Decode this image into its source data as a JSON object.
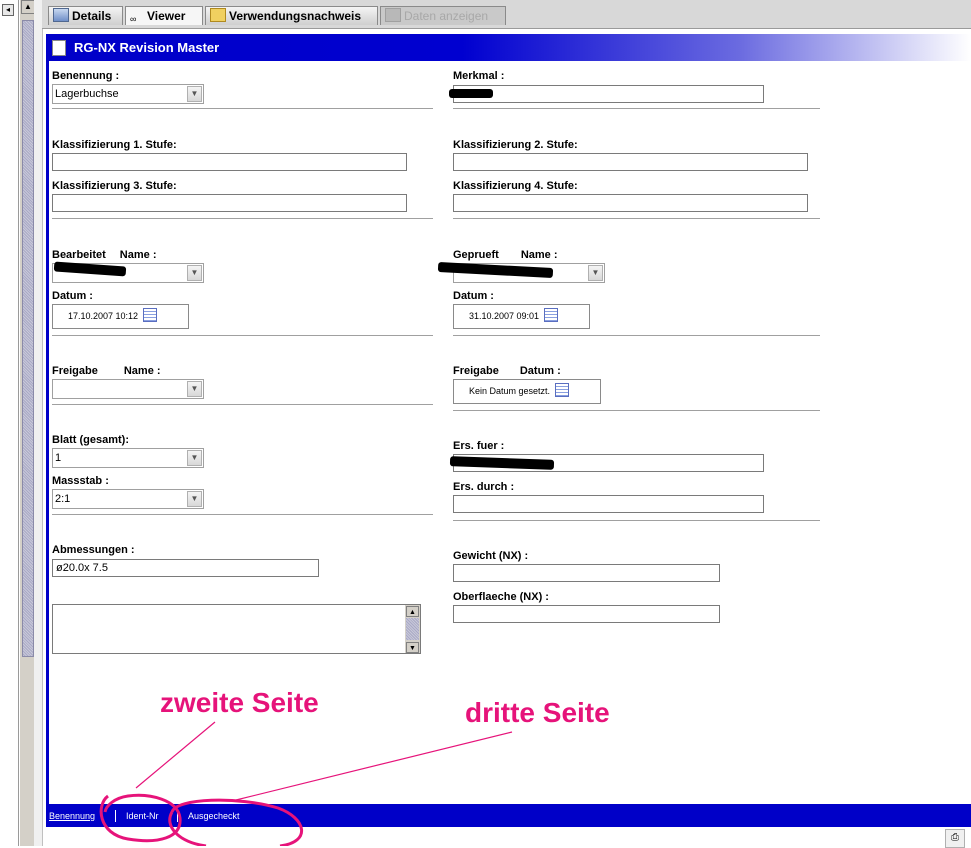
{
  "tabs": [
    {
      "label": "Details",
      "icon": "details-icon",
      "disabled": false
    },
    {
      "label": "Viewer",
      "icon": "glasses-icon",
      "disabled": false
    },
    {
      "label": "Verwendungsnachweis",
      "icon": "folder-icon",
      "disabled": false
    },
    {
      "label": "Daten anzeigen",
      "icon": "data-icon",
      "disabled": true
    }
  ],
  "header": {
    "title": "RG-NX Revision Master"
  },
  "form": {
    "benennung": {
      "label": "Benennung :",
      "value": "Lagerbuchse"
    },
    "merkmal": {
      "label": "Merkmal :",
      "value": ""
    },
    "klass1": {
      "label": "Klassifizierung 1. Stufe:",
      "value": ""
    },
    "klass2": {
      "label": "Klassifizierung 2. Stufe:",
      "value": ""
    },
    "klass3": {
      "label": "Klassifizierung 3. Stufe:",
      "value": ""
    },
    "klass4": {
      "label": "Klassifizierung 4. Stufe:",
      "value": ""
    },
    "bearbeitet": {
      "label_a": "Bearbeitet",
      "label_b": "Name :",
      "value": ""
    },
    "bearbeitet_datum": {
      "label": "Datum :",
      "value": "17.10.2007 10:12"
    },
    "geprueft": {
      "label_a": "Geprueft",
      "label_b": "Name :",
      "value": ""
    },
    "geprueft_datum": {
      "label": "Datum :",
      "value": "31.10.2007 09:01"
    },
    "freigabe_name": {
      "label_a": "Freigabe",
      "label_b": "Name :",
      "value": ""
    },
    "freigabe_datum": {
      "label_a": "Freigabe",
      "label_b": "Datum :",
      "value": "Kein Datum gesetzt."
    },
    "blatt": {
      "label": "Blatt (gesamt):",
      "value": "1"
    },
    "massstab": {
      "label": "Massstab :",
      "value": "2:1"
    },
    "ers_fuer": {
      "label": "Ers. fuer :",
      "value": ""
    },
    "ers_durch": {
      "label": "Ers. durch :",
      "value": ""
    },
    "abmessungen": {
      "label": "Abmessungen :",
      "value": "ø20.0x 7.5"
    },
    "gewicht": {
      "label": "Gewicht (NX) :",
      "value": ""
    },
    "oberflaeche": {
      "label": "Oberflaeche (NX) :",
      "value": ""
    }
  },
  "bottom_links": [
    "Benennung",
    "Ident-Nr",
    "Ausgecheckt"
  ],
  "annotations": {
    "left": "zweite Seite",
    "right": "dritte Seite",
    "color": "#e6137a"
  },
  "colors": {
    "accent": "#0000c8"
  }
}
